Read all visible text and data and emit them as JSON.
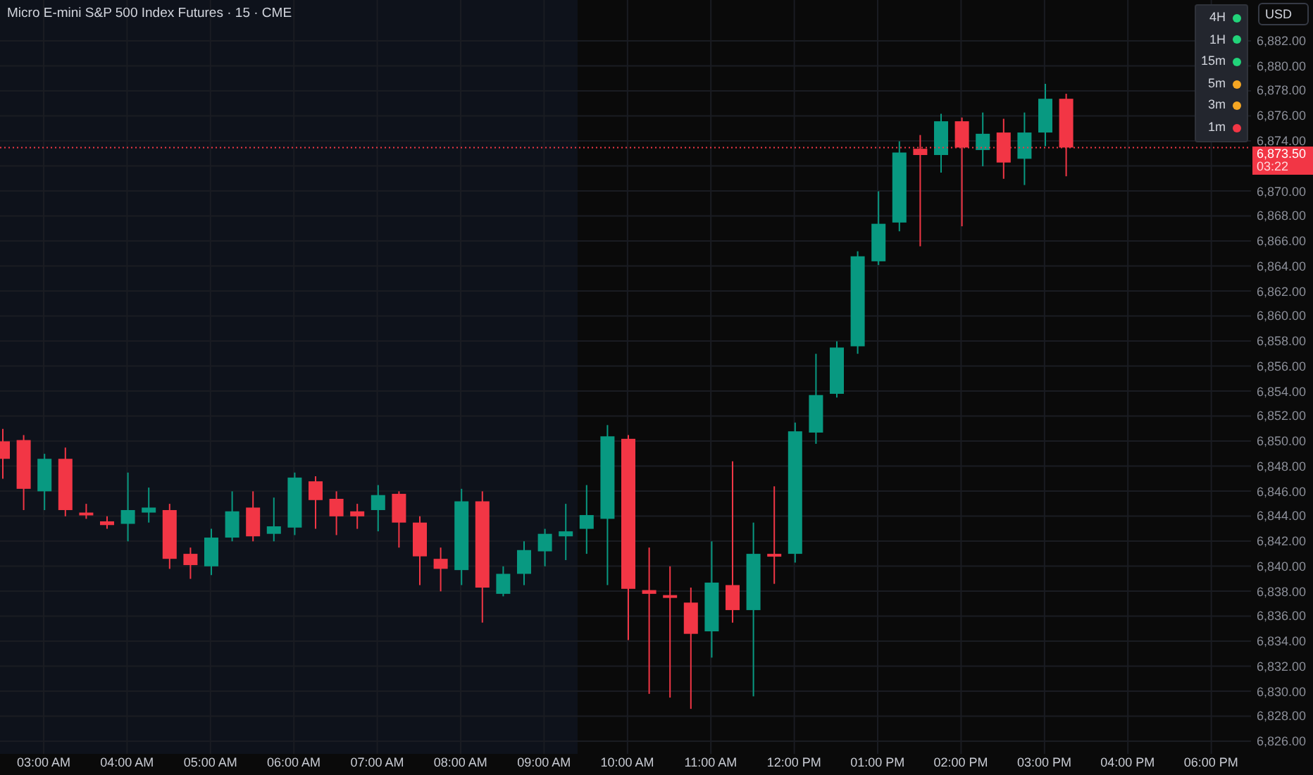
{
  "title": "Micro E-mini S&P 500 Index Futures · 15 · CME",
  "currency": "USD",
  "timeframes": [
    {
      "label": "4H",
      "color": "#22d37a"
    },
    {
      "label": "1H",
      "color": "#22d37a"
    },
    {
      "label": "15m",
      "color": "#22d37a"
    },
    {
      "label": "5m",
      "color": "#f5a623"
    },
    {
      "label": "3m",
      "color": "#f5a623"
    },
    {
      "label": "1m",
      "color": "#f23645"
    }
  ],
  "last_price": {
    "price": "6,873.50",
    "countdown": "03:22"
  },
  "price_axis": {
    "labels_above": [
      "6,882.00",
      "6,880.00",
      "6,878.00",
      "6,876.00",
      "6,874.00"
    ],
    "labels_below": [
      "6,870.00",
      "6,868.00",
      "6,866.00",
      "6,864.00",
      "6,862.00",
      "6,860.00",
      "6,858.00",
      "6,856.00",
      "6,854.00",
      "6,852.00",
      "6,850.00",
      "6,848.00",
      "6,846.00",
      "6,844.00",
      "6,842.00",
      "6,840.00",
      "6,838.00",
      "6,836.00",
      "6,834.00",
      "6,832.00",
      "6,830.00",
      "6,828.00",
      "6,826.00"
    ]
  },
  "time_axis": [
    "03:00 AM",
    "04:00 AM",
    "05:00 AM",
    "06:00 AM",
    "07:00 AM",
    "08:00 AM",
    "09:00 AM",
    "10:00 AM",
    "11:00 AM",
    "12:00 PM",
    "01:00 PM",
    "02:00 PM",
    "03:00 PM",
    "04:00 PM",
    "06:00 PM"
  ]
}
